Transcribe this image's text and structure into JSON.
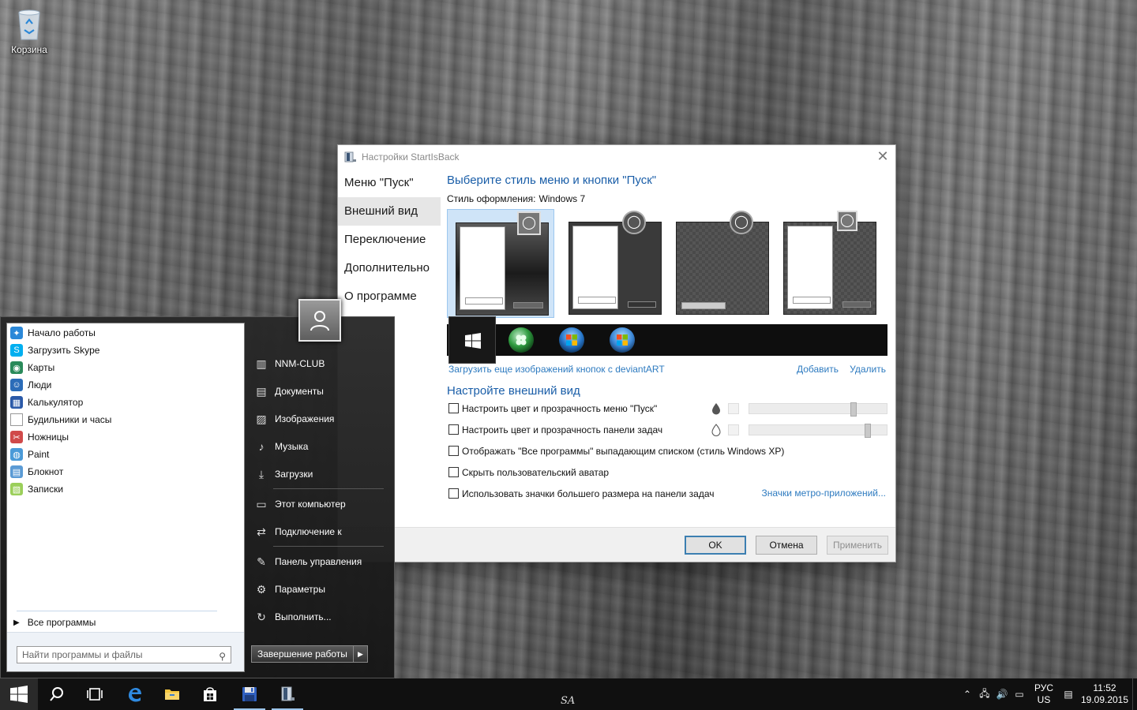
{
  "desktop": {
    "recycle_bin_label": "Корзина"
  },
  "dialog": {
    "title": "Настройки StartIsBack",
    "nav": [
      {
        "label": "Меню \"Пуск\"",
        "active": false
      },
      {
        "label": "Внешний вид",
        "active": true
      },
      {
        "label": "Переключение",
        "active": false
      },
      {
        "label": "Дополнительно",
        "active": false
      },
      {
        "label": "О программе",
        "active": false
      }
    ],
    "heading_style": "Выберите стиль меню и кнопки \"Пуск\"",
    "style_label": "Стиль оформления:",
    "style_value": "Windows 7",
    "download_link": "Загрузить еще изображений кнопок с deviantART",
    "add_link": "Добавить",
    "remove_link": "Удалить",
    "heading_appearance": "Настройте внешний вид",
    "options": [
      {
        "label": "Настроить цвет и прозрачность меню \"Пуск\"",
        "checked": false,
        "transparency": 0.77
      },
      {
        "label": "Настроить цвет и прозрачность панели задач",
        "checked": false,
        "transparency": 0.88
      },
      {
        "label": "Отображать \"Все программы\" выпадающим списком (стиль Windows XP)",
        "checked": false
      },
      {
        "label": "Скрыть пользовательский аватар",
        "checked": false
      },
      {
        "label": "Использовать значки большего размера на панели задач",
        "checked": false
      }
    ],
    "metro_link": "Значки метро-приложений...",
    "buttons": {
      "ok": "OK",
      "cancel": "Отмена",
      "apply": "Применить"
    },
    "selected_style_index": 0
  },
  "start_menu": {
    "apps": [
      {
        "label": "Начало работы",
        "icon": "lightbulb-icon",
        "color": "#2b88d8"
      },
      {
        "label": "Загрузить Skype",
        "icon": "skype-icon",
        "color": "#00aff0"
      },
      {
        "label": "Карты",
        "icon": "maps-icon",
        "color": "#2a8a5a"
      },
      {
        "label": "Люди",
        "icon": "people-icon",
        "color": "#2b6cb8"
      },
      {
        "label": "Калькулятор",
        "icon": "calculator-icon",
        "color": "#2b5aa8"
      },
      {
        "label": "Будильники и часы",
        "icon": "document-icon",
        "color": "#cfcfcf"
      },
      {
        "label": "Ножницы",
        "icon": "scissors-icon",
        "color": "#d04a4a"
      },
      {
        "label": "Paint",
        "icon": "paint-icon",
        "color": "#4a9ad8"
      },
      {
        "label": "Блокнот",
        "icon": "notepad-icon",
        "color": "#5b9bd5"
      },
      {
        "label": "Записки",
        "icon": "sticky-notes-icon",
        "color": "#9bcf5a"
      }
    ],
    "all_programs": "Все программы",
    "search_placeholder": "Найти программы и файлы",
    "places": [
      {
        "label": "NNM-CLUB",
        "icon": "user-folder-icon"
      },
      {
        "label": "Документы",
        "icon": "documents-icon"
      },
      {
        "label": "Изображения",
        "icon": "pictures-icon"
      },
      {
        "label": "Музыка",
        "icon": "music-icon"
      },
      {
        "label": "Загрузки",
        "icon": "downloads-icon"
      },
      {
        "label": "Этот компьютер",
        "icon": "computer-icon"
      },
      {
        "label": "Подключение к",
        "icon": "connect-icon"
      },
      {
        "label": "Панель управления",
        "icon": "control-panel-icon"
      },
      {
        "label": "Параметры",
        "icon": "settings-icon"
      },
      {
        "label": "Выполнить...",
        "icon": "run-icon"
      }
    ],
    "shutdown": "Завершение работы"
  },
  "taskbar": {
    "watermark": "SA",
    "lang_top": "РУС",
    "lang_bottom": "US",
    "time": "11:52",
    "date": "19.09.2015"
  }
}
